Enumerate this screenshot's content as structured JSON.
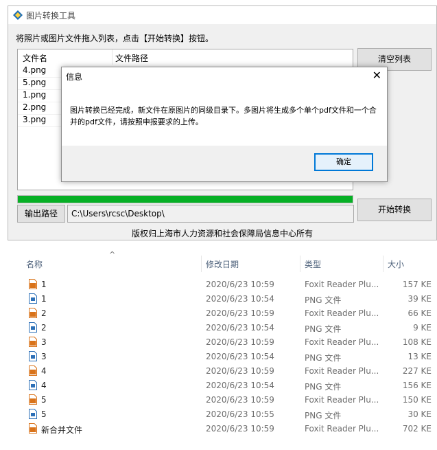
{
  "app": {
    "title": "图片转换工具",
    "instruction": "将照片或图片文件拖入列表，点击【开始转换】按钮。",
    "list": {
      "headers": {
        "name": "文件名",
        "path": "文件路径"
      },
      "rows": [
        "4.png",
        "5.png",
        "1.png",
        "2.png",
        "3.png"
      ]
    },
    "buttons": {
      "clear": "清空列表",
      "start": "开始转换",
      "output": "输出路径"
    },
    "progress": 1.0,
    "output_path": "C:\\Users\\rcsc\\Desktop\\",
    "copyright": "版权归上海市人力资源和社会保障局信息中心所有"
  },
  "dialog": {
    "title": "信息",
    "close_glyph": "✕",
    "message": "图片转换已经完成，新文件在原图片的同级目录下。多图片将生成多个单个pdf文件和一个合并的pdf文件，请按照申报要求的上传。",
    "ok": "确定"
  },
  "explorer": {
    "sort_arrow": "^",
    "headers": {
      "name": "名称",
      "date": "修改日期",
      "type": "类型",
      "size": "大小"
    },
    "rows": [
      {
        "icon": "pdf-icon",
        "name": "1",
        "date": "2020/6/23 10:59",
        "type": "Foxit Reader Plu...",
        "size": "157 KE"
      },
      {
        "icon": "png-icon",
        "name": "1",
        "date": "2020/6/23 10:54",
        "type": "PNG 文件",
        "size": "39 KE"
      },
      {
        "icon": "pdf-icon",
        "name": "2",
        "date": "2020/6/23 10:59",
        "type": "Foxit Reader Plu...",
        "size": "66 KE"
      },
      {
        "icon": "png-icon",
        "name": "2",
        "date": "2020/6/23 10:54",
        "type": "PNG 文件",
        "size": "9 KE"
      },
      {
        "icon": "pdf-icon",
        "name": "3",
        "date": "2020/6/23 10:59",
        "type": "Foxit Reader Plu...",
        "size": "108 KE"
      },
      {
        "icon": "png-icon",
        "name": "3",
        "date": "2020/6/23 10:54",
        "type": "PNG 文件",
        "size": "13 KE"
      },
      {
        "icon": "pdf-icon",
        "name": "4",
        "date": "2020/6/23 10:59",
        "type": "Foxit Reader Plu...",
        "size": "227 KE"
      },
      {
        "icon": "png-icon",
        "name": "4",
        "date": "2020/6/23 10:54",
        "type": "PNG 文件",
        "size": "156 KE"
      },
      {
        "icon": "pdf-icon",
        "name": "5",
        "date": "2020/6/23 10:59",
        "type": "Foxit Reader Plu...",
        "size": "150 KE"
      },
      {
        "icon": "png-icon",
        "name": "5",
        "date": "2020/6/23 10:55",
        "type": "PNG 文件",
        "size": "30 KE"
      },
      {
        "icon": "pdf-icon",
        "name": "新合并文件",
        "date": "2020/6/23 10:59",
        "type": "Foxit Reader Plu...",
        "size": "702 KE"
      }
    ]
  },
  "colors": {
    "progress": "#06b025",
    "accent": "#0078d7",
    "pdf_icon": "#d9731a",
    "png_icon": "#2b6fb7"
  }
}
